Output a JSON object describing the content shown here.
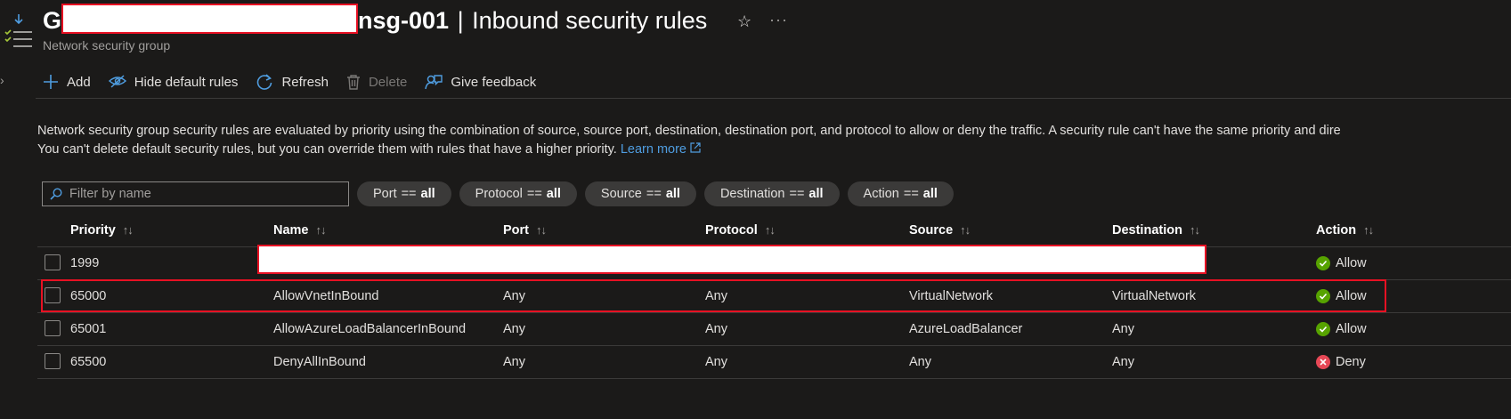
{
  "header": {
    "title_prefix": "G",
    "title_suffix": "nsg-001",
    "title_sep": "|",
    "title_page": "Inbound security rules",
    "subtitle": "Network security group",
    "star_glyph": "☆",
    "more_glyph": "···"
  },
  "toolbar": {
    "add": "Add",
    "hide_default": "Hide default rules",
    "refresh": "Refresh",
    "delete": "Delete",
    "feedback": "Give feedback"
  },
  "info": {
    "line1": "Network security group security rules are evaluated by priority using the combination of source, source port, destination, destination port, and protocol to allow or deny the traffic. A security rule can't have the same priority and dire",
    "line2": "You can't delete default security rules, but you can override them with rules that have a higher priority.",
    "learn_more": "Learn more"
  },
  "filters": {
    "search_placeholder": "Filter by name",
    "equals": "==",
    "pills": [
      {
        "label": "Port",
        "value": "all"
      },
      {
        "label": "Protocol",
        "value": "all"
      },
      {
        "label": "Source",
        "value": "all"
      },
      {
        "label": "Destination",
        "value": "all"
      },
      {
        "label": "Action",
        "value": "all"
      }
    ]
  },
  "table": {
    "sort_glyph": "↑↓",
    "columns": [
      "Priority",
      "Name",
      "Port",
      "Protocol",
      "Source",
      "Destination",
      "Action"
    ],
    "rows": [
      {
        "priority": "1999",
        "name": "",
        "port": "",
        "protocol": "",
        "source": "",
        "destination": "",
        "action": "Allow"
      },
      {
        "priority": "65000",
        "name": "AllowVnetInBound",
        "port": "Any",
        "protocol": "Any",
        "source": "VirtualNetwork",
        "destination": "VirtualNetwork",
        "action": "Allow"
      },
      {
        "priority": "65001",
        "name": "AllowAzureLoadBalancerInBound",
        "port": "Any",
        "protocol": "Any",
        "source": "AzureLoadBalancer",
        "destination": "Any",
        "action": "Allow"
      },
      {
        "priority": "65500",
        "name": "DenyAllInBound",
        "port": "Any",
        "protocol": "Any",
        "source": "Any",
        "destination": "Any",
        "action": "Deny"
      }
    ]
  },
  "colors": {
    "background": "#1b1a19",
    "accent": "#4f9de0",
    "allow": "#57a300",
    "deny": "#e74856",
    "highlight": "#e81123"
  }
}
